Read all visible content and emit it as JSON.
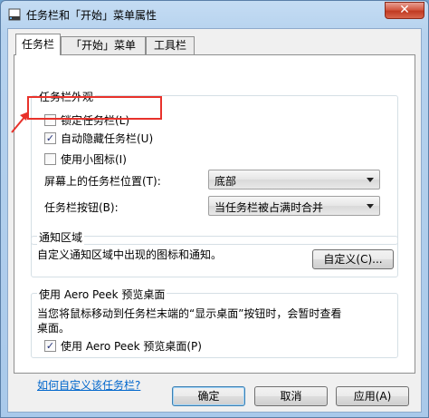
{
  "window": {
    "title": "任务栏和「开始」菜单属性",
    "close_glyph": "✕",
    "title_icon": "taskbar-properties-icon"
  },
  "tabs": [
    {
      "label": "任务栏",
      "active": true
    },
    {
      "label": "「开始」菜单",
      "active": false
    },
    {
      "label": "工具栏",
      "active": false
    }
  ],
  "appearance": {
    "title": "任务栏外观",
    "lock_taskbar": {
      "label": "锁定任务栏(L)",
      "checked": false
    },
    "auto_hide": {
      "label": "自动隐藏任务栏(U)",
      "checked": true
    },
    "small_icons": {
      "label": "使用小图标(I)",
      "checked": false
    },
    "location": {
      "label": "屏幕上的任务栏位置(T):",
      "value": "底部"
    },
    "buttons": {
      "label": "任务栏按钮(B):",
      "value": "当任务栏被占满时合并"
    }
  },
  "notification": {
    "title": "通知区域",
    "description": "自定义通知区域中出现的图标和通知。",
    "customize_label": "自定义(C)..."
  },
  "aero_peek": {
    "title": "使用 Aero Peek 预览桌面",
    "description_line1": "当您将鼠标移动到任务栏末端的“显示桌面”按钮时，会暂时查看",
    "description_line2": "桌面。",
    "checkbox": {
      "label": "使用 Aero Peek 预览桌面(P)",
      "checked": true
    }
  },
  "help_link": "如何自定义该任务栏?",
  "footer": {
    "ok_label": "确定",
    "cancel_label": "取消",
    "apply_label": "应用(A)"
  },
  "check_glyph": "✓",
  "colors": {
    "highlight": "#e8322b",
    "link": "#0066cc",
    "close_button": "#c03a22"
  }
}
